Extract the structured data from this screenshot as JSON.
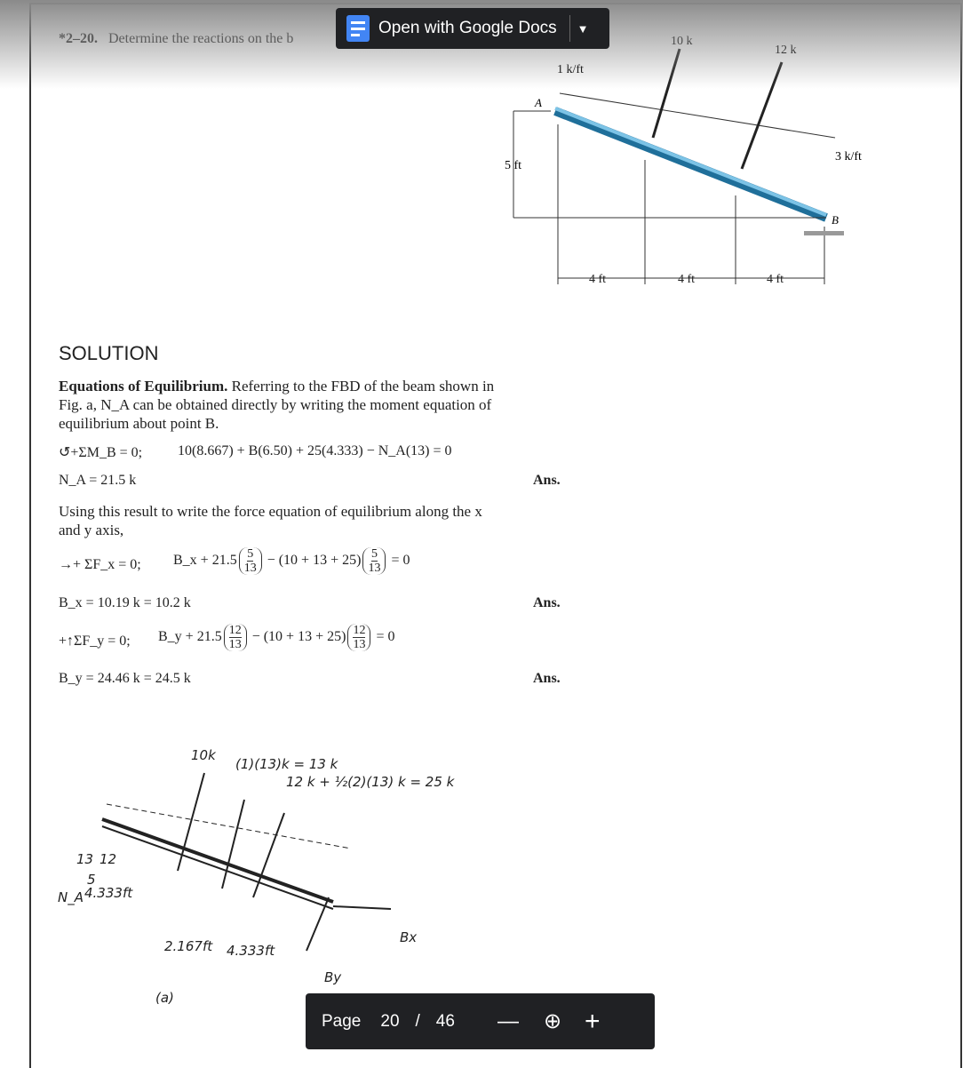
{
  "problem": {
    "number": "*2–20.",
    "text": "Determine the reactions on the b"
  },
  "viewer": {
    "open_with_label": "Open with Google Docs",
    "page_label": "Page",
    "page_current": "20",
    "page_sep": "/",
    "page_total": "46",
    "colors": {
      "toolbar": "#202124",
      "docs_icon": "#4285f4",
      "beam": "#5aaed6"
    }
  },
  "figure": {
    "load_left": "1 k/ft",
    "load_right": "3 k/ft",
    "force1": "10 k",
    "force2": "12 k",
    "point_a": "A",
    "point_b": "B",
    "height": "5 ft",
    "dims": [
      "4 ft",
      "4 ft",
      "4 ft"
    ]
  },
  "solution": {
    "heading": "SOLUTION",
    "intro_bold": "Equations of Equilibrium.",
    "intro": " Referring to the FBD of the beam shown in Fig. a, N_A can be obtained directly by writing the moment equation of equilibrium about point B.",
    "moment_lhs": "↺+ΣM_B = 0;",
    "moment_rhs": "10(8.667) + B(6.50) + 25(4.333) − N_A(13) = 0",
    "na_result": "N_A = 21.5 k",
    "para2": "Using this result to write the force equation of equilibrium along the x and y axis,",
    "fx_lhs": "→+ ΣF_x = 0;",
    "fx_rhs_a": "B_x + 21.5",
    "fx_rhs_b": "− (10 + 13 + 25)",
    "fx_num": "5",
    "fx_den": "13",
    "fx_tail": "= 0",
    "bx_result": "B_x = 10.19 k = 10.2 k",
    "fy_lhs": "+↑ΣF_y = 0;",
    "fy_rhs_a": "B_y + 21.5",
    "fy_rhs_b": "− (10 + 13 + 25)",
    "fy_num": "12",
    "fy_den": "13",
    "fy_tail": "= 0",
    "by_result": "B_y = 24.46 k = 24.5 k",
    "ans": "Ans."
  },
  "fbd": {
    "l1": "10k",
    "l2": "(1)(13)k = 13 k",
    "l3": "12 k + ½(2)(13) k = 25 k",
    "t13": "13",
    "t12": "12",
    "t5": "5",
    "na": "N_A",
    "d1": "4.333ft",
    "d2": "2.167ft",
    "d3": "4.333ft",
    "bx": "Bx",
    "by": "By",
    "caption": "(a)"
  }
}
